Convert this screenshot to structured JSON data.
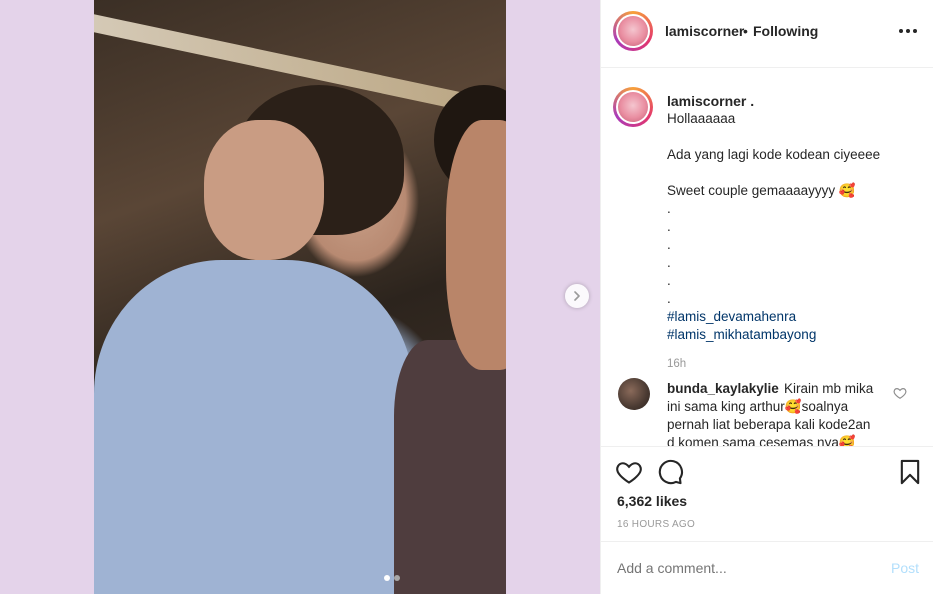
{
  "post": {
    "author": "lamiscorner",
    "follow_status": "Following",
    "separator": "•",
    "caption_author": "lamiscorner .",
    "caption_lines": [
      "Hollaaaaaa",
      "Ada yang lagi kode kodean ciyeeee",
      "Sweet couple gemaaaayyyy 🥰",
      ".",
      ".",
      ".",
      ".",
      ".",
      "."
    ],
    "hashtags": [
      "#lamis_devamahenra",
      "#lamis_mikhatambayong"
    ],
    "caption_time": "16h",
    "comment": {
      "user": "bunda_kaylakylie",
      "lines": [
        "Kirain mb mika",
        "ini sama king arthur🥰soalnya",
        "pernah liat beberapa kali kode2an",
        "d komen sama cesemas nya🥰"
      ]
    },
    "likes": "6,362 likes",
    "posted_ago": "16 HOURS AGO",
    "comment_placeholder": "Add a comment...",
    "post_button": "Post",
    "carousel": {
      "count": 2,
      "active_index": 0
    }
  },
  "icons": {
    "more": "more-options-icon",
    "next": "chevron-right-icon",
    "like": "heart-icon",
    "comment": "comment-icon",
    "save": "bookmark-icon",
    "comment_like": "heart-small-icon"
  },
  "colors": {
    "background": "#e4d3ea",
    "hashtag": "#003569",
    "post_disabled": "#b2dffc",
    "muted": "#999999"
  }
}
